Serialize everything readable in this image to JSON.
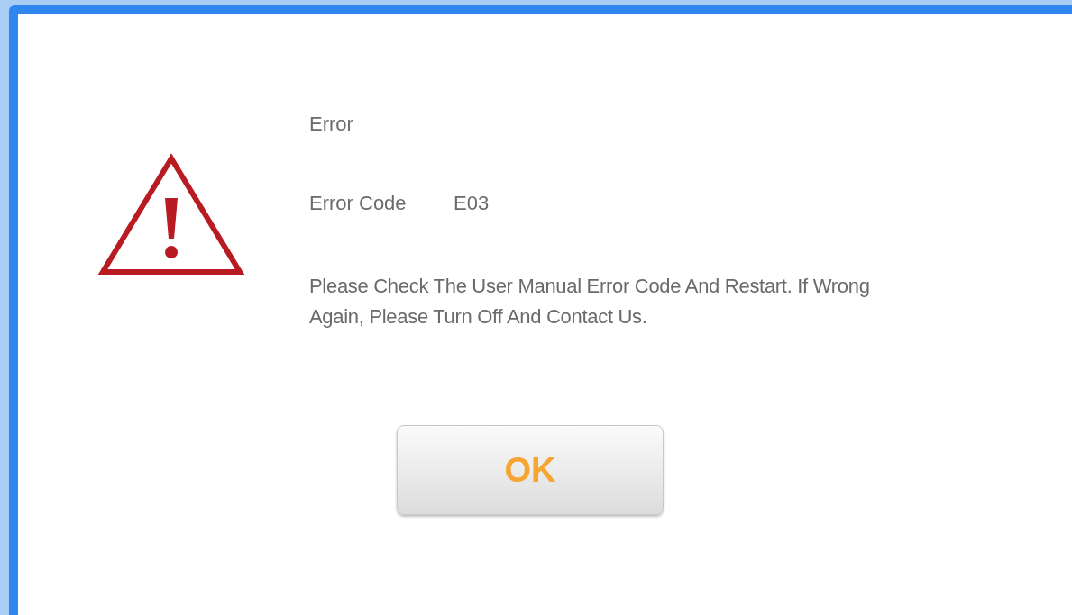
{
  "dialog": {
    "title": "Error",
    "code_label": "Error Code",
    "code_value": "E03",
    "message": "Please Check The User Manual Error Code And Restart. If Wrong Again, Please Turn Off And Contact Us.",
    "buttons": [
      "OK"
    ]
  }
}
